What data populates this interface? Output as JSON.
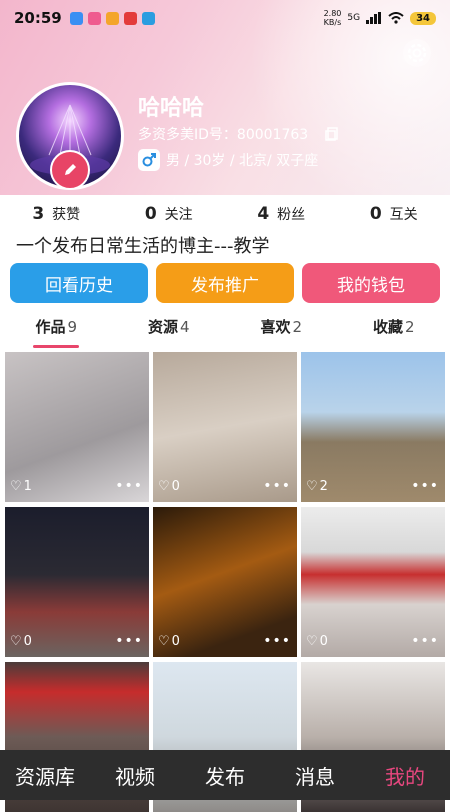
{
  "status_bar": {
    "time": "20:59",
    "net_speed": "2.80\nKB/s",
    "signal": "5G",
    "battery": "34"
  },
  "profile": {
    "name": "哈哈哈",
    "id_text": "多资多美ID号：80001763",
    "info": "男 / 30岁 / 北京/ 双子座",
    "bio": "一个发布日常生活的博主---教学"
  },
  "stats": [
    {
      "value": "3",
      "label": "获赞"
    },
    {
      "value": "0",
      "label": "关注"
    },
    {
      "value": "4",
      "label": "粉丝"
    },
    {
      "value": "0",
      "label": "互关"
    }
  ],
  "buttons": [
    {
      "label": "回看历史",
      "color": "#2a9ee8"
    },
    {
      "label": "发布推广",
      "color": "#f59d17"
    },
    {
      "label": "我的钱包",
      "color": "#f0587a"
    }
  ],
  "tabs": [
    {
      "label": "作品",
      "count": "9",
      "active": true
    },
    {
      "label": "资源",
      "count": "4",
      "active": false
    },
    {
      "label": "喜欢",
      "count": "2",
      "active": false
    },
    {
      "label": "收藏",
      "count": "2",
      "active": false
    }
  ],
  "posts": [
    {
      "likes": "1"
    },
    {
      "likes": "0"
    },
    {
      "likes": "2"
    },
    {
      "likes": "0"
    },
    {
      "likes": "0"
    },
    {
      "likes": "0"
    },
    {
      "likes": ""
    },
    {
      "likes": ""
    },
    {
      "likes": ""
    }
  ],
  "more_glyph": "•••",
  "tab_bar": [
    {
      "label": "资源库",
      "active": false
    },
    {
      "label": "视频",
      "active": false
    },
    {
      "label": "发布",
      "active": false
    },
    {
      "label": "消息",
      "active": false
    },
    {
      "label": "我的",
      "active": true
    }
  ],
  "colors": {
    "accent": "#e8466b",
    "tabbar_bg": "#2d2d2d",
    "tab_active": "#e8477f"
  }
}
